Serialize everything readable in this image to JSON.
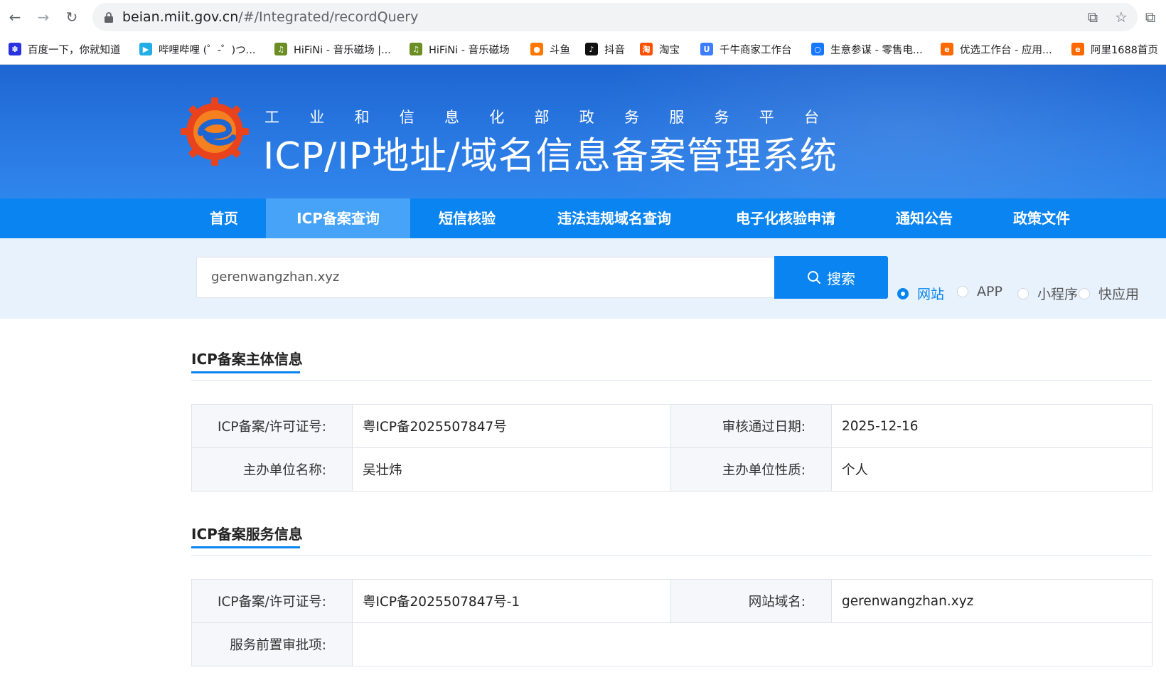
{
  "browser": {
    "url_host": "beian.miit.gov.cn",
    "url_path": "/#/Integrated/recordQuery",
    "bookmarks": [
      {
        "label": "百度一下，你就知道",
        "icon": "baidu-icon",
        "color": "#2932e1"
      },
      {
        "label": "哔哩哔哩 (゜-゜)つ...",
        "icon": "bilibili-icon",
        "color": "#23ade5"
      },
      {
        "label": "HiFiNi - 音乐磁场 |...",
        "icon": "hifini-icon",
        "color": "#6b8e23"
      },
      {
        "label": "HiFiNi - 音乐磁场",
        "icon": "hifini-icon",
        "color": "#6b8e23"
      },
      {
        "label": "斗鱼",
        "icon": "douyu-icon",
        "color": "#ff7700"
      },
      {
        "label": "抖音",
        "icon": "douyin-icon",
        "color": "#111111"
      },
      {
        "label": "淘宝",
        "icon": "taobao-icon",
        "color": "#ff5000"
      },
      {
        "label": "千牛商家工作台",
        "icon": "qianniu-icon",
        "color": "#3d7eff"
      },
      {
        "label": "生意参谋 - 零售电...",
        "icon": "shengyi-icon",
        "color": "#1677ff"
      },
      {
        "label": "优选工作台 - 应用...",
        "icon": "alibaba-icon",
        "color": "#ff6a00"
      },
      {
        "label": "阿里1688首页",
        "icon": "alibaba-icon",
        "color": "#ff6a00"
      }
    ]
  },
  "header": {
    "subtitle_chars": [
      "工",
      "业",
      "和",
      "信",
      "息",
      "化",
      "部",
      "政",
      "务",
      "服",
      "务",
      "平",
      "台"
    ],
    "title": "ICP/IP地址/域名信息备案管理系统",
    "brand_color": "#0a84f0"
  },
  "nav": {
    "items": [
      {
        "label": "首页"
      },
      {
        "label": "ICP备案查询"
      },
      {
        "label": "短信核验"
      },
      {
        "label": "违法违规域名查询"
      },
      {
        "label": "电子化核验申请"
      },
      {
        "label": "通知公告"
      },
      {
        "label": "政策文件"
      }
    ],
    "active": "ICP备案查询"
  },
  "search": {
    "value": "gerenwangzhan.xyz",
    "button_label": "搜索",
    "types": [
      {
        "label": "网站",
        "checked": true
      },
      {
        "label": "APP",
        "checked": false
      },
      {
        "label": "小程序",
        "checked": false
      },
      {
        "label": "快应用",
        "checked": false
      }
    ]
  },
  "subject_info": {
    "title": "ICP备案主体信息",
    "rows": [
      {
        "label1": "ICP备案/许可证号:",
        "value1": "粤ICP备2025507847号",
        "label2": "审核通过日期:",
        "value2": "2025-12-16"
      },
      {
        "label1": "主办单位名称:",
        "value1": "吴壮炜",
        "label2": "主办单位性质:",
        "value2": "个人"
      }
    ]
  },
  "service_info": {
    "title": "ICP备案服务信息",
    "rows": [
      {
        "label1": "ICP备案/许可证号:",
        "value1": "粤ICP备2025507847号-1",
        "label2": "网站域名:",
        "value2": "gerenwangzhan.xyz"
      },
      {
        "label1": "服务前置审批项:",
        "value1": ""
      }
    ]
  }
}
